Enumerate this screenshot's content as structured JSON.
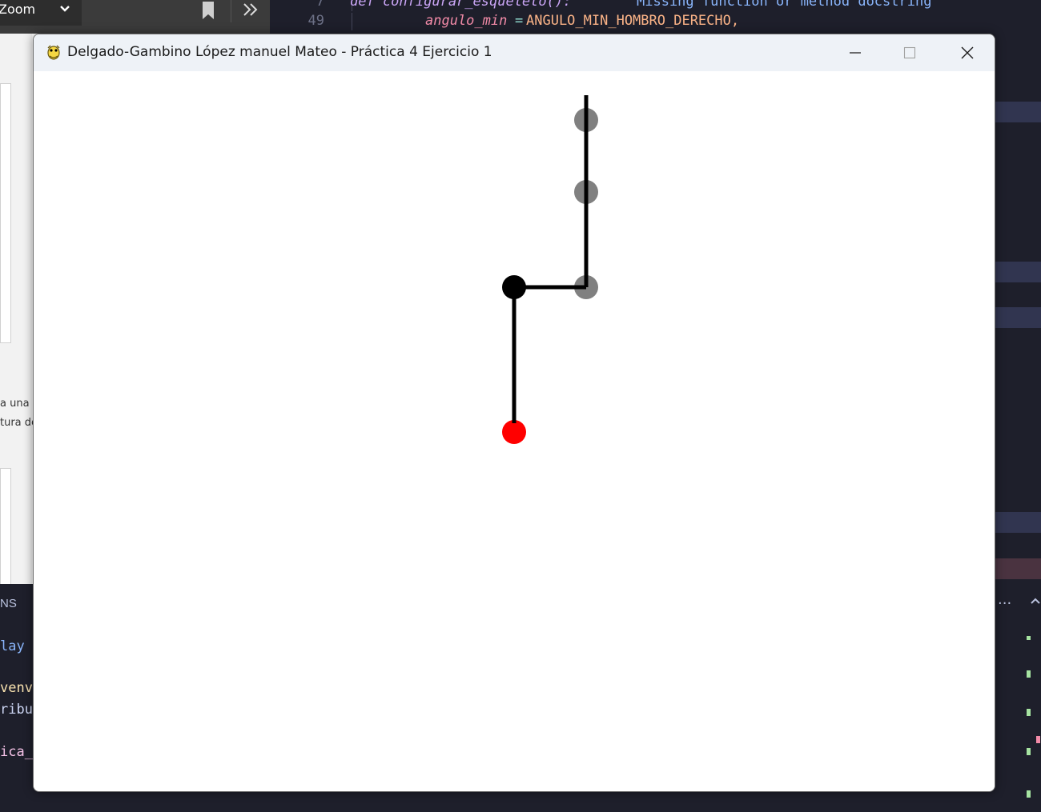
{
  "window": {
    "title": "Delgado-Gambino López manuel Mateo - Práctica 4 Ejercicio 1",
    "icon": "pygame-snake-icon",
    "controls": [
      "minimize-icon",
      "maximize-icon",
      "close-icon"
    ]
  },
  "skeleton": {
    "bone_color": "#000000",
    "root_color": "#000000",
    "joint_color": "#808080",
    "end_effector_color": "#ff0000",
    "joints": [
      {
        "name": "end-effector",
        "color": "#ff0000"
      },
      {
        "name": "root",
        "color": "#000000"
      },
      {
        "name": "joint-1",
        "color": "#808080"
      },
      {
        "name": "joint-2",
        "color": "#808080"
      },
      {
        "name": "joint-3",
        "color": "#808080"
      }
    ]
  },
  "pdf_viewer": {
    "zoom_label": "Zoom",
    "text_lines": [
      "a una d",
      "tura de"
    ]
  },
  "editor": {
    "lines": [
      {
        "number": "7",
        "code": "def configurar_esqueleto():",
        "diagnostic": "Missing function or method docstring"
      },
      {
        "number": "49",
        "param": "angulo_min",
        "op": "=",
        "value": "ANGULO_MIN_HOMBRO_DERECHO,"
      }
    ]
  },
  "terminal": {
    "tab_label": "NS",
    "lines": [
      "lay a",
      "venv/",
      "ribut",
      "ica_e"
    ],
    "more_label": "···"
  }
}
